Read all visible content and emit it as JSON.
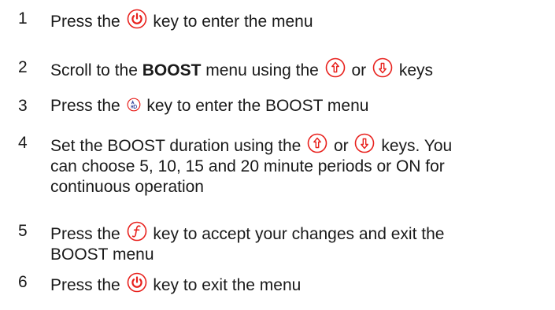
{
  "steps": [
    {
      "number": "1",
      "pre": "Press the ",
      "icon": "power-icon",
      "post": " key to enter the menu"
    },
    {
      "number": "2",
      "pre": "Scroll to the ",
      "bold": "BOOST",
      "mid": " menu using the ",
      "icon1": "up-arrow-icon",
      "or": " or ",
      "icon2": "down-arrow-icon",
      "post": " keys"
    },
    {
      "number": "3",
      "pre": "Press the ",
      "icon": "auto-icon",
      "post": " key to enter the BOOST menu"
    },
    {
      "number": "4",
      "pre": "Set the BOOST duration using the ",
      "icon1": "up-arrow-icon",
      "or": " or ",
      "icon2": "down-arrow-icon",
      "post": " keys. You",
      "line2": "can choose 5, 10, 15 and 20 minute periods or ON for",
      "line3": "continuous operation"
    },
    {
      "number": "5",
      "pre": "Press the ",
      "icon": "function-icon",
      "post": " key to accept your changes and exit the",
      "line2": "BOOST menu"
    },
    {
      "number": "6",
      "pre": "Press the ",
      "icon": "power-icon",
      "post": " key to exit the menu"
    }
  ],
  "colors": {
    "icon_orange": "#e8211d",
    "icon_blue": "#3f4fa0",
    "text": "#1a1a1a"
  }
}
